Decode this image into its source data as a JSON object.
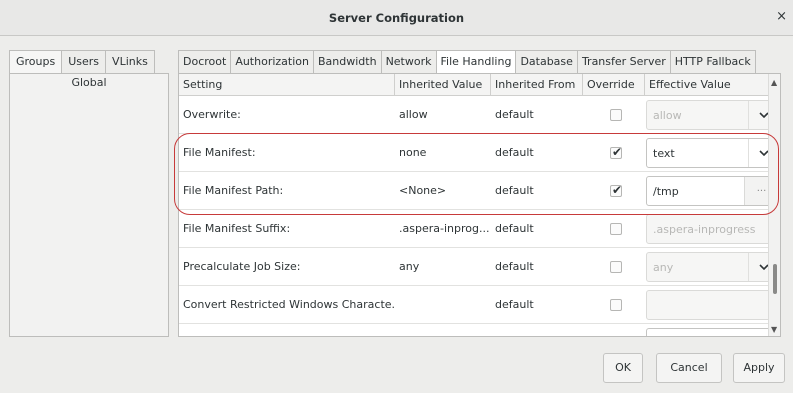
{
  "window": {
    "title": "Server Configuration",
    "close_glyph": "×"
  },
  "left_tabs": [
    "Groups",
    "Users",
    "VLinks"
  ],
  "left_list": [
    "Global"
  ],
  "right_tabs": [
    "Docroot",
    "Authorization",
    "Bandwidth",
    "Network",
    "File Handling",
    "Database",
    "Transfer Server",
    "HTTP Fallback"
  ],
  "active_right_tab": "File Handling",
  "table": {
    "headers": [
      "Setting",
      "Inherited Value",
      "Inherited From",
      "Override",
      "Effective Value"
    ],
    "rows": [
      {
        "setting": "Overwrite:",
        "inherited_value": "allow",
        "inherited_from": "default",
        "override": false,
        "effective": "allow",
        "control": "dropdown",
        "enabled": false
      },
      {
        "setting": "File Manifest:",
        "inherited_value": "none",
        "inherited_from": "default",
        "override": true,
        "effective": "text",
        "control": "dropdown",
        "enabled": true
      },
      {
        "setting": "File Manifest Path:",
        "inherited_value": "<None>",
        "inherited_from": "default",
        "override": true,
        "effective": "/tmp",
        "control": "browse",
        "enabled": true
      },
      {
        "setting": "File Manifest Suffix:",
        "inherited_value": ".aspera-inprog...",
        "inherited_from": "default",
        "override": false,
        "effective": ".aspera-inprogress",
        "control": "text",
        "enabled": false
      },
      {
        "setting": "Precalculate Job Size:",
        "inherited_value": "any",
        "inherited_from": "default",
        "override": false,
        "effective": "any",
        "control": "dropdown",
        "enabled": false
      },
      {
        "setting": "Convert Restricted Windows Characte...",
        "inherited_value": "",
        "inherited_from": "default",
        "override": false,
        "effective": "",
        "control": "text",
        "enabled": false
      }
    ]
  },
  "browse_label": "...",
  "buttons": {
    "ok": "OK",
    "cancel": "Cancel",
    "apply": "Apply"
  },
  "colors": {
    "highlight": "#c73a3a",
    "accent": "#2e3436"
  }
}
